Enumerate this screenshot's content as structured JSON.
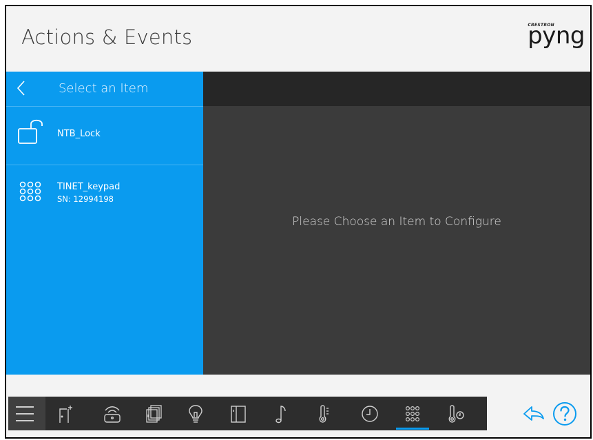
{
  "header": {
    "title": "Actions & Events",
    "logo_small": "CRESTRON",
    "logo_text": "pyng"
  },
  "sidebar": {
    "title": "Select an Item",
    "items": [
      {
        "icon": "lock-icon",
        "label": "NTB_Lock"
      },
      {
        "icon": "keypad-icon",
        "label": "TINET_keypad",
        "sub": "SN: 12994198"
      }
    ]
  },
  "content": {
    "message": "Please Choose an Item to Configure"
  },
  "toolbar": {
    "items": [
      {
        "icon": "menu-icon"
      },
      {
        "icon": "door-icon"
      },
      {
        "icon": "remote-icon"
      },
      {
        "icon": "shades-icon"
      },
      {
        "icon": "lightbulb-icon"
      },
      {
        "icon": "room-icon"
      },
      {
        "icon": "music-note-icon"
      },
      {
        "icon": "thermometer-icon"
      },
      {
        "icon": "clock-icon"
      },
      {
        "icon": "keypad-icon",
        "active": true
      },
      {
        "icon": "thermostat-icon"
      }
    ],
    "accent_color": "#0a9bef"
  },
  "colors": {
    "sidebar": "#0a9bef",
    "content": "#3b3b3b",
    "toolbar": "#2d2d2d"
  }
}
